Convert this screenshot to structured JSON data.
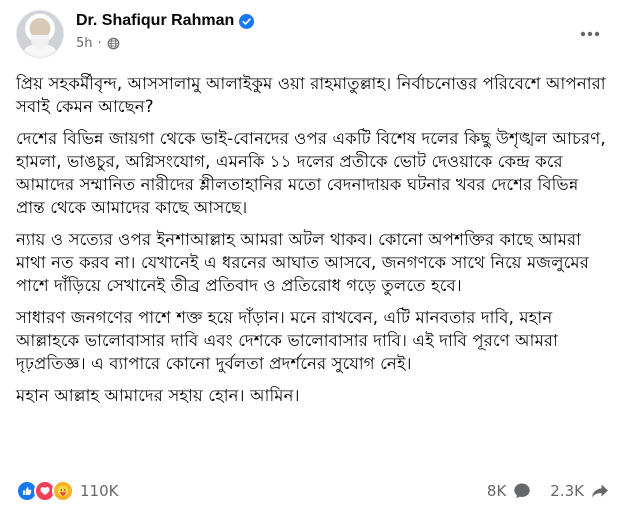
{
  "author": {
    "name": "Dr. Shafiqur Rahman",
    "verified": true
  },
  "meta": {
    "time": "5h",
    "audience_icon": "globe-icon",
    "separator": "·"
  },
  "post": {
    "paragraphs": [
      "প্রিয় সহকর্মীবৃন্দ, আসসালামু আলাইকুম ওয়া রাহমাতুল্লাহ। নির্বাচনোত্তর পরিবেশে আপনারা সবাই কেমন আছেন?",
      "দেশের বিভিন্ন জায়গা থেকে ভাই-বোনদের ওপর একটি বিশেষ দলের কিছু উশৃঙ্খল আচরণ, হামলা, ভাঙচুর, অগ্নিসংযোগ, এমনকি ১১ দলের প্রতীকে ভোট দেওয়াকে কেন্দ্র করে আমাদের সম্মানিত নারীদের শ্লীলতাহানির মতো বেদনাদায়ক ঘটনার খবর দেশের বিভিন্ন প্রান্ত থেকে আমাদের কাছে আসছে।",
      "ন্যায় ও সত্যের ওপর ইনশাআল্লাহ আমরা অটল থাকব। কোনো অপশক্তির কাছে আমরা মাথা নত করব না। যেখানেই এ ধরনের আঘাত আসবে, জনগণকে সাথে নিয়ে মজলুমের পাশে দাঁড়িয়ে সেখানেই তীব্র প্রতিবাদ ও প্রতিরোধ গড়ে তুলতে হবে।",
      "সাধারণ জনগণের পাশে শক্ত হয়ে দাঁড়ান। মনে রাখবেন, এটি মানবতার দাবি, মহান আল্লাহকে ভালোবাসার দাবি এবং দেশকে ভালোবাসার দাবি। এই দাবি পূরণে আমরা দৃঢ়প্রতিজ্ঞ। এ ব্যাপারে কোনো দুর্বলতা প্রদর্শনের সুযোগ নেই।",
      "মহান আল্লাহ আমাদের সহায় হোন। আমিন।"
    ]
  },
  "stats": {
    "reactions_count": "110K",
    "reaction_types": [
      "like",
      "love",
      "care"
    ],
    "comments": "8K",
    "shares": "2.3K"
  },
  "colors": {
    "accent": "#1877f2",
    "secondary_text": "#65676b",
    "love": "#f33e58",
    "care": "#f7b125"
  }
}
